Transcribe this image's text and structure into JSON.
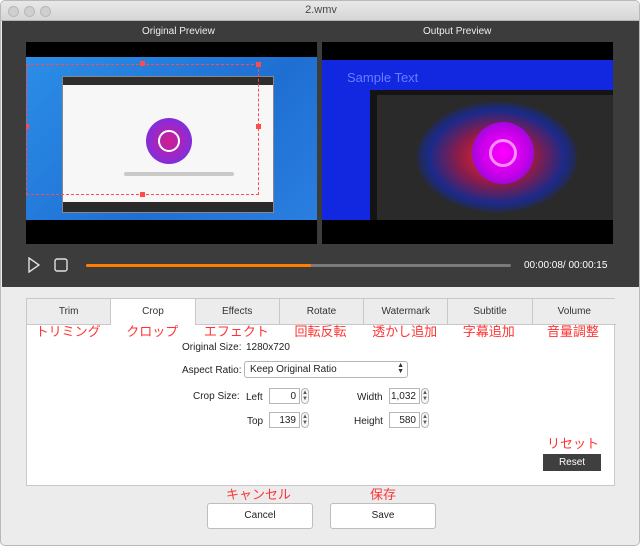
{
  "window": {
    "title": "2.wmv"
  },
  "preview": {
    "original_label": "Original Preview",
    "output_label": "Output  Preview",
    "sample_text": "Sample Text"
  },
  "playback": {
    "progress_fraction": 0.53,
    "timecode": "00:00:08/ 00:00:15"
  },
  "tabs": [
    {
      "label": "Trim",
      "jp": "トリミング"
    },
    {
      "label": "Crop",
      "jp": "クロップ"
    },
    {
      "label": "Effects",
      "jp": "エフェクト"
    },
    {
      "label": "Rotate",
      "jp": "回転反転"
    },
    {
      "label": "Watermark",
      "jp": "透かし追加"
    },
    {
      "label": "Subtitle",
      "jp": "字幕追加"
    },
    {
      "label": "Volume",
      "jp": "音量調整"
    }
  ],
  "active_tab": "Crop",
  "crop": {
    "original_size_label": "Original Size:",
    "original_size_value": "1280x720",
    "aspect_ratio_label": "Aspect Ratio:",
    "aspect_ratio_value": "Keep Original Ratio",
    "crop_size_label": "Crop Size:",
    "left_label": "Left",
    "left_value": "0",
    "top_label": "Top",
    "top_value": "139",
    "width_label": "Width",
    "width_value": "1,032",
    "height_label": "Height",
    "height_value": "580"
  },
  "reset": {
    "label": "Reset",
    "jp": "リセット"
  },
  "buttons": {
    "cancel": "Cancel",
    "cancel_jp": "キャンセル",
    "save": "Save",
    "save_jp": "保存"
  },
  "colors": {
    "accent": "#ff7d00",
    "annotation": "#ff3333"
  }
}
